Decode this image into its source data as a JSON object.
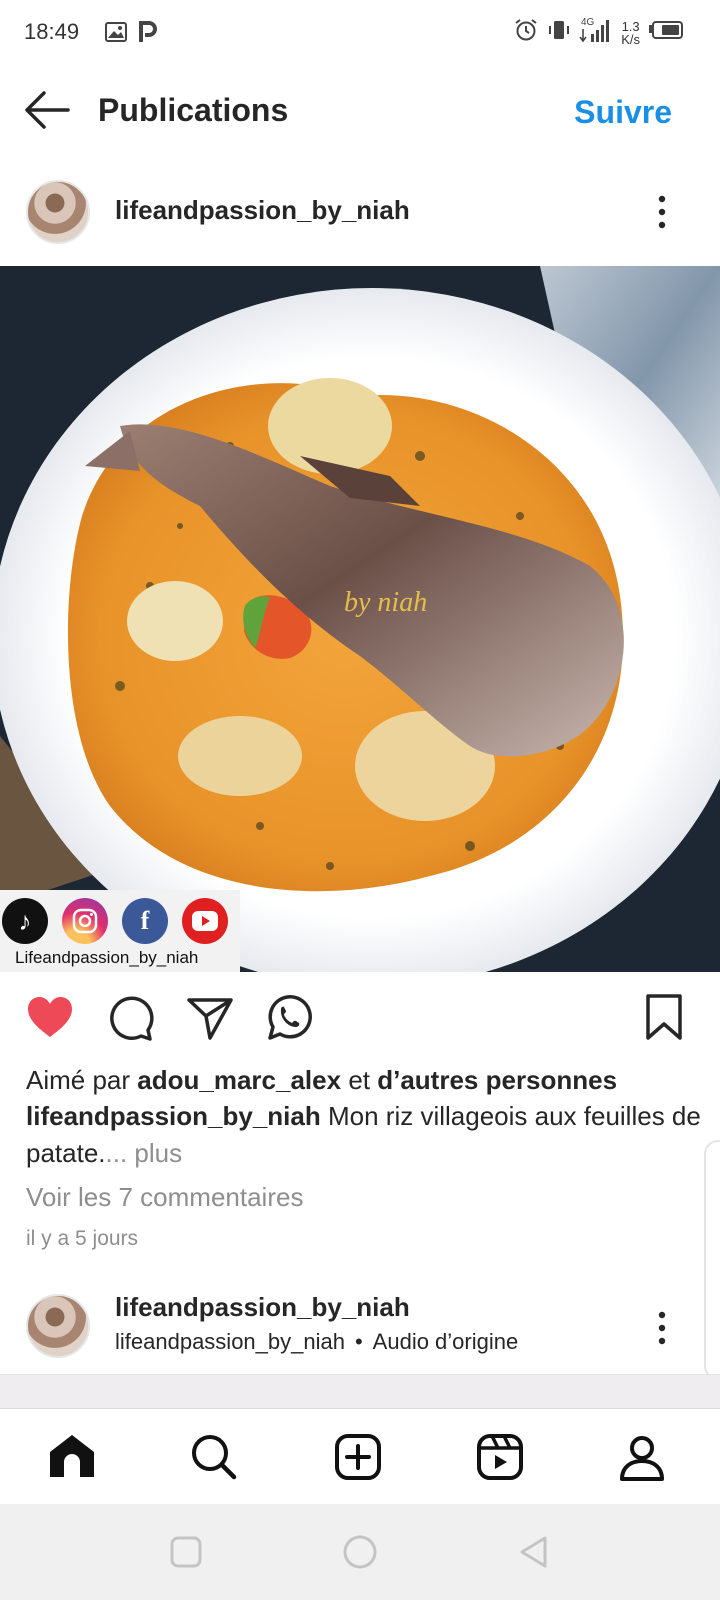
{
  "status_bar": {
    "time": "18:49",
    "left_icons": [
      "image-icon",
      "parking-p-icon"
    ],
    "network": "4G",
    "speed_value": "1.3",
    "speed_unit": "K/s"
  },
  "header": {
    "title": "Publications",
    "follow_label": "Suivre",
    "accent_color": "#1a8fe6"
  },
  "post": {
    "author": "lifeandpassion_by_niah",
    "image_watermark": "by niah",
    "social_handle": "Lifeandpassion_by_niah",
    "liked_prefix": "Aimé par",
    "liked_user": "adou_marc_alex",
    "liked_middle": "et",
    "liked_suffix": "d’autres personnes",
    "caption_user": "lifeandpassion_by_niah",
    "caption_text": "Mon riz villageois aux feuilles de patate.",
    "caption_ellipsis": "...",
    "caption_more": "plus",
    "comments_link": "Voir les 7 commentaires",
    "date": "il y a 5 jours",
    "liked": true,
    "like_color": "#ed4956"
  },
  "next_post": {
    "author": "lifeandpassion_by_niah",
    "audio_user": "lifeandpassion_by_niah",
    "audio_label": "Audio d’origine"
  },
  "bottom_nav": {
    "items": [
      "home-icon",
      "search-icon",
      "create-icon",
      "reels-icon",
      "profile-icon"
    ]
  }
}
